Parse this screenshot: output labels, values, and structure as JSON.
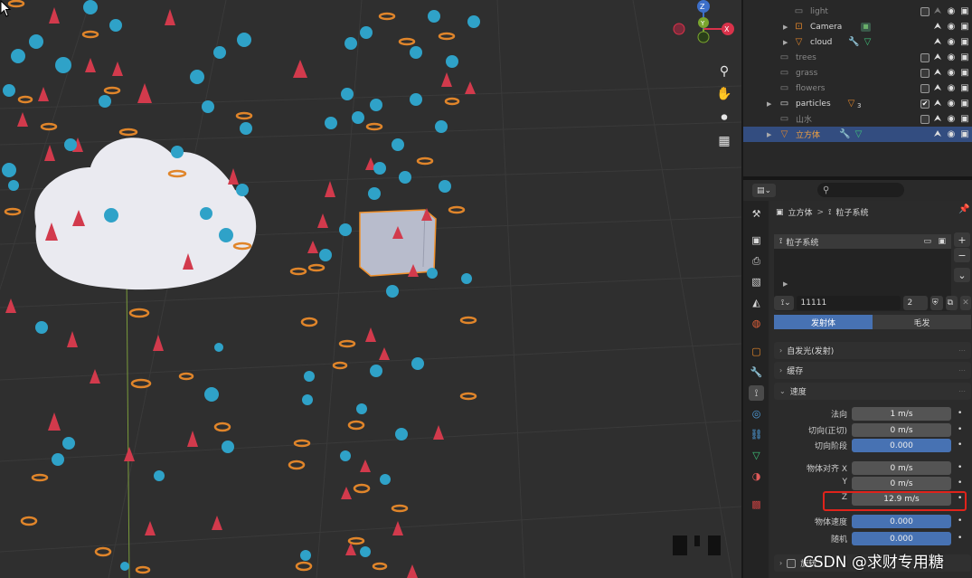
{
  "outliner": {
    "rows": [
      {
        "label": "light",
        "visible": false
      },
      {
        "label": "Camera",
        "visible": true
      },
      {
        "label": "cloud",
        "visible": true
      },
      {
        "label": "trees",
        "visible": false
      },
      {
        "label": "grass",
        "visible": false
      },
      {
        "label": "flowers",
        "visible": false
      },
      {
        "label": "particles",
        "visible": true,
        "badge": "3"
      },
      {
        "label": "山水",
        "visible": false
      },
      {
        "label": "立方体",
        "visible": true
      }
    ],
    "check_mark": "✔"
  },
  "properties": {
    "search_placeholder": "",
    "breadcrumb": {
      "object": "立方体",
      "sep": ">",
      "system": "粒子系统"
    },
    "particle_system_item": "粒子系统",
    "settings_name": "11111",
    "users_count": "2",
    "type_tabs": [
      "发射体",
      "毛发"
    ],
    "active_type": "发射体",
    "panels": {
      "emission": "自发光(发射)",
      "cache": "缓存",
      "velocity": "速度",
      "rotation": "旋转"
    },
    "velocity": [
      {
        "label": "法向",
        "value": "1 m/s",
        "blue": false
      },
      {
        "label": "切向(正切)",
        "value": "0 m/s",
        "blue": false
      },
      {
        "label": "切向阶段",
        "value": "0.000",
        "blue": true
      },
      {
        "label": "物体对齐 X",
        "value": "0 m/s",
        "blue": false
      },
      {
        "label": "Y",
        "value": "0 m/s",
        "blue": false
      },
      {
        "label": "Z",
        "value": "12.9 m/s",
        "blue": false
      },
      {
        "label": "物体速度",
        "value": "0.000",
        "blue": true
      },
      {
        "label": "随机",
        "value": "0.000",
        "blue": true
      }
    ]
  },
  "gizmo": {
    "z": "Z",
    "y": "Y",
    "x": "X"
  },
  "watermark": "CSDN @求财专用糖",
  "colors": {
    "selection": "#334d80",
    "accent_blue": "#4772b3",
    "highlight_red": "#e0231b",
    "viewport": "#2f2f2f"
  }
}
